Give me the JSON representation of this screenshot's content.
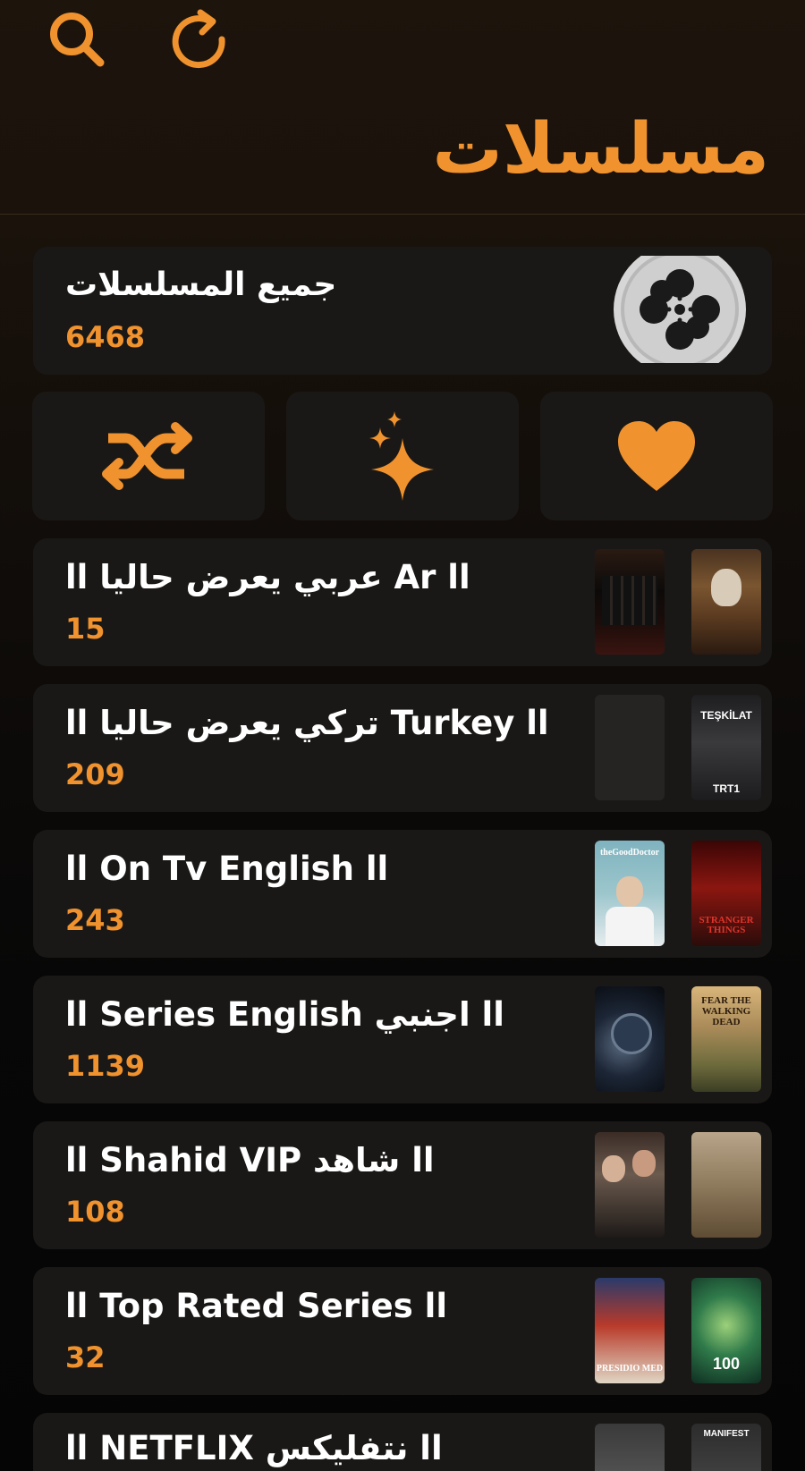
{
  "header": {
    "title": "مسلسلات",
    "search_icon": "search-icon",
    "refresh_icon": "refresh-icon"
  },
  "all_series": {
    "label": "جميع المسلسلات",
    "count": "6468",
    "icon": "film-reel-icon"
  },
  "actions": [
    {
      "name": "shuffle",
      "icon": "shuffle-icon"
    },
    {
      "name": "new",
      "icon": "sparkles-icon"
    },
    {
      "name": "favorites",
      "icon": "heart-icon"
    }
  ],
  "categories": [
    {
      "label": "ll عربي يعرض حاليا Ar ll",
      "count": "15"
    },
    {
      "label": "ll تركي يعرض حاليا Turkey ll",
      "count": "209",
      "poster_text": "TEŞKİLAT",
      "poster_caption": "TRT1"
    },
    {
      "label": "ll On Tv English ll",
      "count": "243",
      "poster_text_1": "theGoodDoctor",
      "poster_text_2": "STRANGER THINGS"
    },
    {
      "label": "ll Series English اجنبي ll",
      "count": "1139",
      "poster_text_2": "FEAR THE WALKING DEAD"
    },
    {
      "label": "ll Shahid VIP شاهد ll",
      "count": "108"
    },
    {
      "label": "ll Top Rated Series ll",
      "count": "32",
      "poster_text_1": "PRESIDIO MED",
      "poster_text_2": "100"
    },
    {
      "label": "ll NETFLIX نتفليكس ll",
      "count": "",
      "poster_text_2": "MANIFEST"
    }
  ],
  "colors": {
    "accent": "#f0922e",
    "card": "#1a1816",
    "background": "#0a0908"
  }
}
